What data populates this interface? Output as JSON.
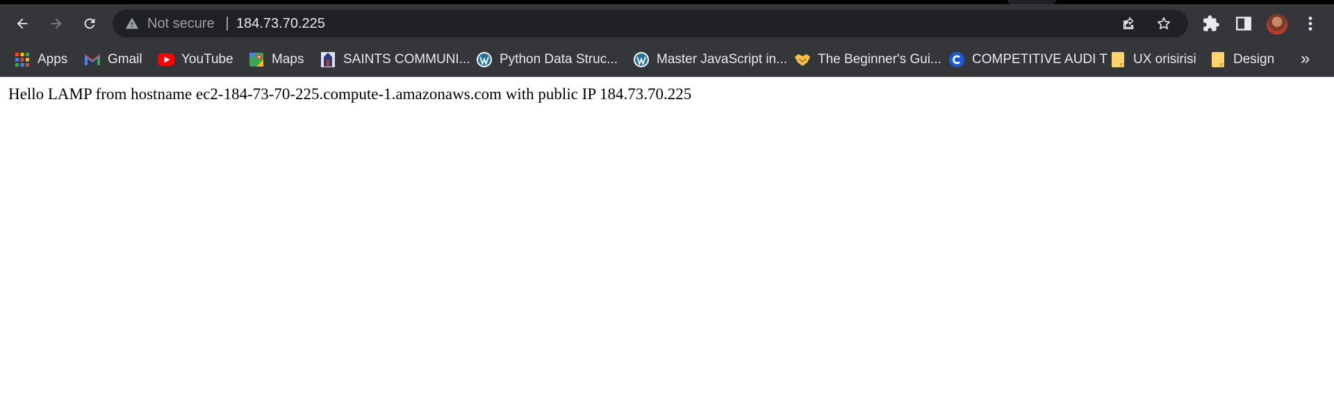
{
  "browser": {
    "nav": {
      "back_icon": "back-arrow-icon",
      "forward_icon": "forward-arrow-icon",
      "reload_icon": "reload-icon"
    },
    "omnibox": {
      "security_status": "Not secure",
      "url": "184.73.70.225",
      "warning_icon": "warning-triangle-icon",
      "share_icon": "share-icon",
      "bookmark_icon": "star-icon"
    },
    "toolbar_icons": [
      "extensions-puzzle-icon",
      "side-panel-icon",
      "profile-avatar",
      "menu-kebab-icon"
    ],
    "bookmarks": [
      {
        "label": "Apps",
        "icon": "apps-grid-icon"
      },
      {
        "label": "Gmail",
        "icon": "gmail-icon"
      },
      {
        "label": "YouTube",
        "icon": "youtube-icon"
      },
      {
        "label": "Maps",
        "icon": "maps-icon"
      },
      {
        "label": "SAINTS COMMUNI...",
        "icon": "saints-favicon"
      },
      {
        "label": "Python  Data Struc...",
        "icon": "wordpress-icon"
      },
      {
        "label": "Master JavaScript in...",
        "icon": "wordpress-icon"
      },
      {
        "label": "The Beginner's Gui...",
        "icon": "handshake-icon"
      },
      {
        "label": "COMPETITIVE AUDI T",
        "icon": "c-logo-icon"
      },
      {
        "label": "UX orisirisi",
        "icon": "note-icon"
      },
      {
        "label": "Design",
        "icon": "note-icon"
      }
    ],
    "overflow_label": "»"
  },
  "page": {
    "text": "Hello LAMP from hostname ec2-184-73-70-225.compute-1.amazonaws.com with public IP 184.73.70.225"
  },
  "colors": {
    "toolbar": "#35363a",
    "omnibox": "#202124",
    "text_light": "#e8eaed",
    "text_muted": "#9aa0a6"
  }
}
